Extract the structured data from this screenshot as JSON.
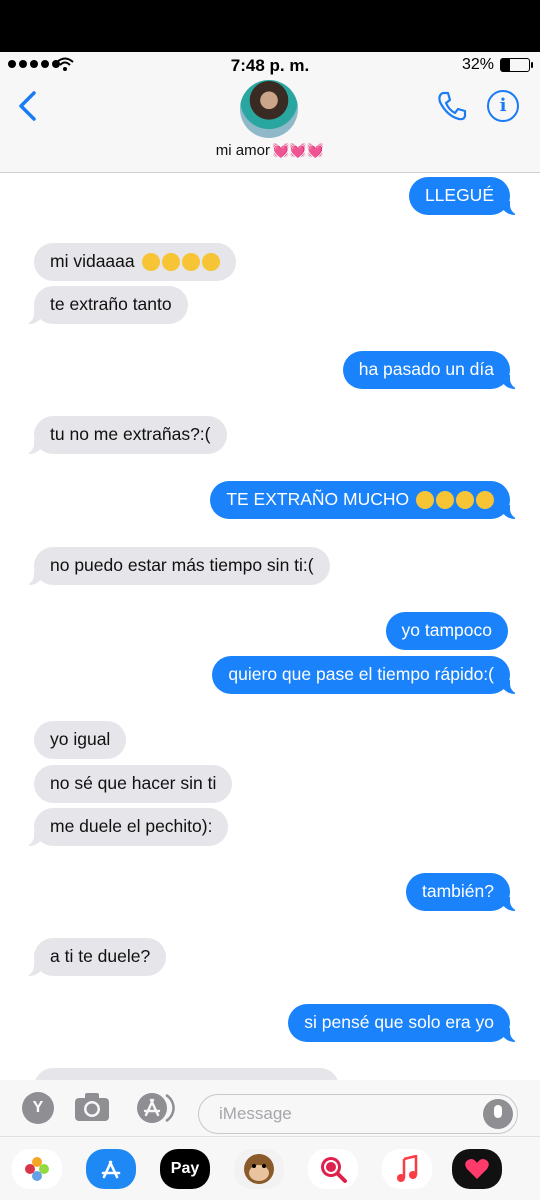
{
  "status": {
    "time": "7:48 p. m.",
    "battery": "32%"
  },
  "header": {
    "contact_name": "mi amor",
    "hearts": "💓💓💓"
  },
  "messages": [
    {
      "text": "LLEGUÉ",
      "from": "me"
    },
    {
      "text": "mi vidaaaa",
      "from": "them",
      "emoji": 4
    },
    {
      "text": "te extraño tanto",
      "from": "them"
    },
    {
      "text": "ha pasado un día",
      "from": "me"
    },
    {
      "text": "tu no me extrañas?:(",
      "from": "them"
    },
    {
      "text": "TE EXTRAÑO MUCHO",
      "from": "me",
      "emoji": 4
    },
    {
      "text": "no puedo estar más tiempo sin ti:(",
      "from": "them"
    },
    {
      "text": "yo tampoco",
      "from": "me"
    },
    {
      "text": "quiero que pase el tiempo rápido:(",
      "from": "me"
    },
    {
      "text": "yo igual",
      "from": "them"
    },
    {
      "text": "no sé que hacer sin ti",
      "from": "them"
    },
    {
      "text": "me duele el pechito):",
      "from": "them"
    },
    {
      "text": "también?",
      "from": "me"
    },
    {
      "text": "a ti te duele?",
      "from": "them"
    },
    {
      "text": "si pensé que solo era yo",
      "from": "me"
    }
  ],
  "composer": {
    "placeholder": "iMessage",
    "y_button": "Y"
  },
  "app_drawer": {
    "apple_pay": "Pay"
  },
  "colors": {
    "outgoing": "#1a82fb",
    "incoming": "#e5e5ea",
    "accent": "#1a7cf5"
  }
}
